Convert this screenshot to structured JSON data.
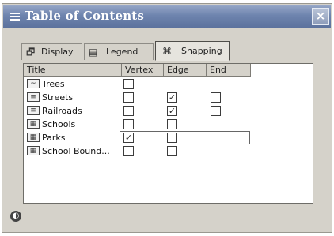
{
  "window": {
    "title": "Table of Contents",
    "close_glyph": "×"
  },
  "tabs": [
    {
      "label": "Display",
      "icon": "display-icon",
      "icon_glyph": "🗗"
    },
    {
      "label": "Legend",
      "icon": "legend-icon",
      "icon_glyph": "▤"
    },
    {
      "label": "Snapping",
      "icon": "snapping-icon",
      "icon_glyph": "⌘"
    }
  ],
  "table": {
    "headers": {
      "title": "Title",
      "vertex": "Vertex",
      "edge": "Edge",
      "end": "End"
    },
    "rows": [
      {
        "title": "Trees",
        "icon_glyph": "~",
        "vertex": false,
        "edge": null,
        "end": null
      },
      {
        "title": "Streets",
        "icon_glyph": "≡",
        "vertex": false,
        "edge": true,
        "end": false
      },
      {
        "title": "Railroads",
        "icon_glyph": "≡",
        "vertex": false,
        "edge": true,
        "end": false
      },
      {
        "title": "Schools",
        "icon_glyph": "▦",
        "vertex": false,
        "edge": false,
        "end": null
      },
      {
        "title": "Parks",
        "icon_glyph": "▦",
        "vertex": true,
        "edge": false,
        "end": null,
        "selected": true
      },
      {
        "title": "School Bound...",
        "icon_glyph": "▦",
        "vertex": false,
        "edge": false,
        "end": null
      }
    ]
  },
  "status": {
    "icon": "globe-icon",
    "glyph": "◐"
  }
}
